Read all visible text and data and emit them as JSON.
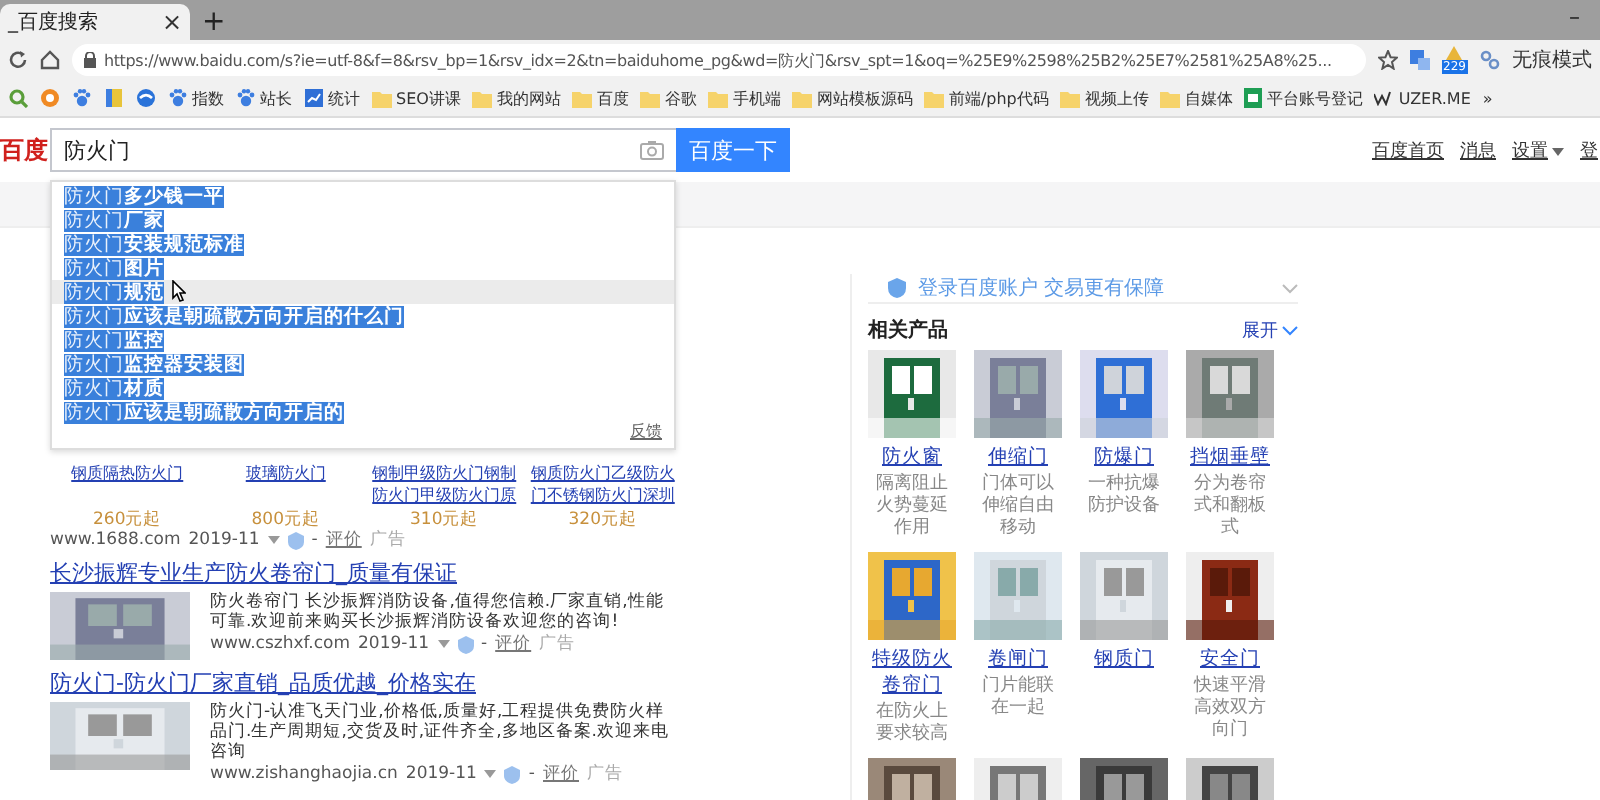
{
  "browser": {
    "tab_title": "_百度搜索",
    "tab_close": "×",
    "new_tab": "+",
    "minimize": "–",
    "url": "https://www.baidu.com/s?ie=utf-8&f=8&rsv_bp=1&rsv_idx=2&tn=baiduhome_pg&wd=防火门&rsv_spt=1&oq=%25E9%2598%25B2%25E7%2581%25A8%25...",
    "badge": "229",
    "profile": "无痕模式"
  },
  "bookmarks": [
    {
      "kind": "search"
    },
    {
      "kind": "orange"
    },
    {
      "kind": "paw"
    },
    {
      "kind": "green"
    },
    {
      "kind": "swirl"
    },
    {
      "kind": "paw",
      "label": "指数"
    },
    {
      "kind": "paw",
      "label": "站长"
    },
    {
      "kind": "chart",
      "label": "统计"
    },
    {
      "kind": "folder",
      "label": "SEO讲课"
    },
    {
      "kind": "folder",
      "label": "我的网站"
    },
    {
      "kind": "folder",
      "label": "百度"
    },
    {
      "kind": "folder",
      "label": "谷歌"
    },
    {
      "kind": "folder",
      "label": "手机端"
    },
    {
      "kind": "folder",
      "label": "网站模板源码"
    },
    {
      "kind": "folder",
      "label": "前端/php代码"
    },
    {
      "kind": "folder",
      "label": "视频上传"
    },
    {
      "kind": "folder",
      "label": "自媒体"
    },
    {
      "kind": "sheet",
      "label": "平台账号登记"
    },
    {
      "kind": "wave",
      "label": "UZER.ME"
    }
  ],
  "bookmarks_more": "»",
  "header": {
    "logo": "百度",
    "query": "防火门",
    "button": "百度一下",
    "links": [
      {
        "label": "百度首页",
        "dropdown": false
      },
      {
        "label": "消息",
        "dropdown": false
      },
      {
        "label": "设置",
        "dropdown": true
      },
      {
        "label": "登",
        "dropdown": false
      }
    ]
  },
  "suggestions": [
    {
      "text": "防火门**多少钱一平**",
      "hovered": false
    },
    {
      "text": "防火门**厂家**",
      "hovered": false
    },
    {
      "text": "防火门**安装规范标准**",
      "hovered": false
    },
    {
      "text": "防火门**图片**",
      "hovered": false
    },
    {
      "text": "防火门**规范**",
      "hovered": true
    },
    {
      "text": "防火门**应该是朝疏散方向开启的什么门**",
      "hovered": false
    },
    {
      "text": "防火门**监控**",
      "hovered": false
    },
    {
      "text": "防火门**监控器安装图**",
      "hovered": false
    },
    {
      "text": "防火门**材质**",
      "hovered": false
    },
    {
      "text": "防火门**应该是朝疏散方向开启的**",
      "hovered": false
    }
  ],
  "suggest_feedback": "反馈",
  "ad_products": [
    {
      "title": "钢质隔热防火门",
      "price": "260元起"
    },
    {
      "title": "玻璃防火门",
      "price": "800元起"
    },
    {
      "title": "钢制甲级防火门钢制防火门甲级防火门原",
      "price": "310元起"
    },
    {
      "title": "钢质防火门乙级防火门不锈钢防火门深圳",
      "price": "320元起"
    }
  ],
  "ad_source": {
    "url": "www.1688.com",
    "date": "2019-11",
    "dash": "-",
    "rate": "评价",
    "ad": "广告"
  },
  "results": [
    {
      "title": "长沙振辉专业生产防火卷帘门_质量有保证",
      "description": "防火卷帘门 长沙振辉消防设备,值得您信赖.厂家直销,性能可靠.欢迎前来购买长沙振辉消防设备欢迎您的咨询!",
      "source": {
        "url": "www.cszhxf.com",
        "date": "2019-11",
        "dash": "-",
        "rate": "评价",
        "ad": "广告"
      }
    },
    {
      "title": "防火门-防火门厂家直销_品质优越_价格实在",
      "description": "防火门-认准飞天门业,价格低,质量好,工程提供免费防火样品门.生产周期短,交货及时,证件齐全,多地区备案.欢迎来电咨询",
      "source": {
        "url": "www.zishanghaojia.cn",
        "date": "2019-11",
        "dash": "-",
        "rate": "评价",
        "ad": "广告"
      }
    }
  ],
  "side": {
    "login": "登录百度账户 交易更有保障",
    "related": "相关产品",
    "expand": "展开",
    "products": [
      {
        "kind": "picture",
        "name": "防火窗",
        "desc": "隔离阻止火势蔓延作用"
      },
      {
        "kind": "picture",
        "name": "伸缩门",
        "desc": "门体可以伸缩自由移动"
      },
      {
        "kind": "picture",
        "name": "防爆门",
        "desc": "一种抗爆防护设备"
      },
      {
        "kind": "picture",
        "name": "挡烟垂壁",
        "desc": "分为卷帘式和翻板式"
      },
      {
        "kind": "picture",
        "name": "特级防火卷帘门",
        "desc": "在防火上要求较高"
      },
      {
        "kind": "picture",
        "name": "卷闸门",
        "desc": "门片能联在一起"
      },
      {
        "kind": "picture",
        "name": "钢质门"
      },
      {
        "kind": "picture",
        "name": "安全门",
        "desc": "快速平滑高效双方向门"
      },
      {
        "kind": "picture"
      },
      {
        "kind": "picture"
      },
      {
        "kind": "picture"
      },
      {
        "kind": "picture"
      }
    ]
  }
}
